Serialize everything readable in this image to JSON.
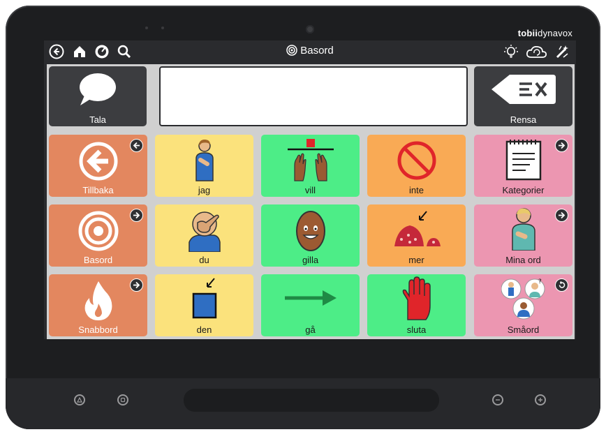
{
  "device": {
    "brand_bold": "tobii",
    "brand_rest": "dynavox"
  },
  "topbar": {
    "title": "Basord",
    "left_icons": [
      "back-circle-icon",
      "home-icon",
      "dashboard-icon",
      "search-icon"
    ],
    "right_icons": [
      "lightbulb-icon",
      "cloud-sync-icon",
      "edit-wand-icon"
    ]
  },
  "message_bar": {
    "speak_label": "Tala",
    "text": "",
    "clear_label": "Rensa"
  },
  "grid": {
    "left_column": [
      {
        "label": "Tillbaka",
        "icon": "back-arrow-icon",
        "badge": "back"
      },
      {
        "label": "Basord",
        "icon": "target-icon",
        "badge": "forward"
      },
      {
        "label": "Snabbord",
        "icon": "flame-icon",
        "badge": "forward"
      }
    ],
    "words": [
      {
        "label": "jag",
        "color": "#fbe27c",
        "icon": "person-self-icon"
      },
      {
        "label": "vill",
        "color": "#4ded87",
        "icon": "hands-reach-icon"
      },
      {
        "label": "inte",
        "color": "#f9aa55",
        "icon": "no-sign-icon"
      },
      {
        "label": "du",
        "color": "#fbe27c",
        "icon": "pointing-hand-icon"
      },
      {
        "label": "gilla",
        "color": "#4ded87",
        "icon": "smiley-egg-icon"
      },
      {
        "label": "mer",
        "color": "#f9aa55",
        "icon": "more-pile-icon"
      },
      {
        "label": "den",
        "color": "#fbe27c",
        "icon": "square-pointer-icon"
      },
      {
        "label": "gå",
        "color": "#4ded87",
        "icon": "arrow-right-icon"
      },
      {
        "label": "sluta",
        "color": "#4ded87",
        "icon": "stop-hand-icon"
      }
    ],
    "right_column": [
      {
        "label": "Kategorier",
        "icon": "notepad-icon",
        "badge": "forward"
      },
      {
        "label": "Mina ord",
        "icon": "person-me-icon",
        "badge": "forward"
      },
      {
        "label": "Småord",
        "icon": "people-group-icon",
        "badge": "return"
      }
    ]
  },
  "colors": {
    "nav_orange": "#e3875f",
    "yellow": "#fbe27c",
    "green": "#4ded87",
    "amber": "#f9aa55",
    "pink": "#ec96b1",
    "dark_tile": "#3c3d40"
  }
}
